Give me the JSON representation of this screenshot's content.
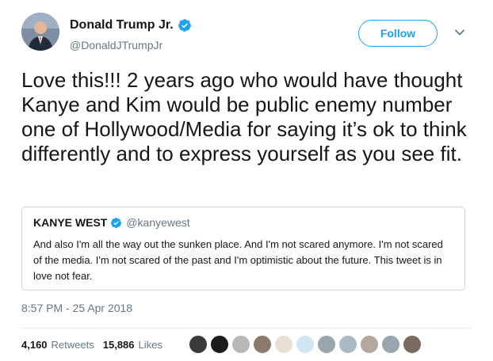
{
  "author": {
    "name": "Donald Trump Jr.",
    "handle": "@DonaldJTrumpJr",
    "verified_icon": "verified-badge-icon",
    "avatar_icon": "avatar-image"
  },
  "follow_label": "Follow",
  "menu_icon": "chevron-down-icon",
  "tweet_text": "Love this!!! 2 years ago who would have thought Kanye and Kim would be public enemy number one of Hollywood/Media for saying it’s ok to think differently and to express yourself as you see fit.",
  "quoted": {
    "name": "KANYE WEST",
    "handle": "@kanyewest",
    "text": "And also I'm all the way out the sunken place. And I'm not scared anymore. I'm not scared of the media. I'm not scared of the past and I'm optimistic about the future. This tweet is in love not fear."
  },
  "timestamp": "8:57 PM - 25 Apr 2018",
  "stats": {
    "retweets_count": "4,160",
    "retweets_label": "Retweets",
    "likes_count": "15,886",
    "likes_label": "Likes"
  },
  "colors": {
    "accent": "#1da1f2",
    "secondary_text": "#657786",
    "border": "#ccd6dd"
  },
  "liker_avatars": [
    "#3b3b3b",
    "#1c1c1c",
    "#b8b8b8",
    "#8a7a6a",
    "#e8e0d4",
    "#cfe6f3",
    "#9aa6ad",
    "#aab9c6",
    "#b3a7a0",
    "#9aa6ad",
    "#7a6a60"
  ]
}
